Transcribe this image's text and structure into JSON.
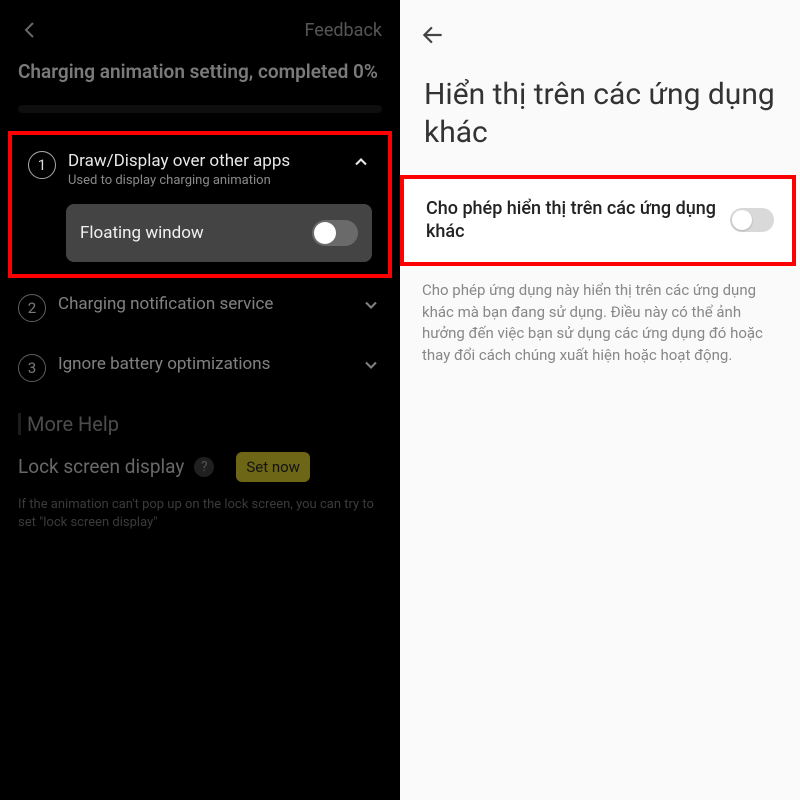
{
  "left": {
    "feedback": "Feedback",
    "heading": "Charging animation setting, completed 0%",
    "step1": {
      "num": "1",
      "title": "Draw/Display over other apps",
      "sub": "Used to display charging animation",
      "floating_label": "Floating window"
    },
    "step2": {
      "num": "2",
      "title": "Charging notification service"
    },
    "step3": {
      "num": "3",
      "title": "Ignore battery optimizations"
    },
    "more_help": "More Help",
    "lock_label": "Lock screen display",
    "help_q": "?",
    "set_now": "Set now",
    "lock_help": "If the animation can't pop up on the lock screen, you can try to set \"lock screen display\""
  },
  "right": {
    "title": "Hiển thị trên các ứng dụng khác",
    "perm_label": "Cho phép hiển thị trên các ứng dụng khác",
    "perm_desc": "Cho phép ứng dụng này hiển thị trên các ứng dụng khác mà bạn đang sử dụng. Điều này có thể ảnh hưởng đến việc bạn sử dụng các ứng dụng đó hoặc thay đổi cách chúng xuất hiện hoặc hoạt động."
  }
}
